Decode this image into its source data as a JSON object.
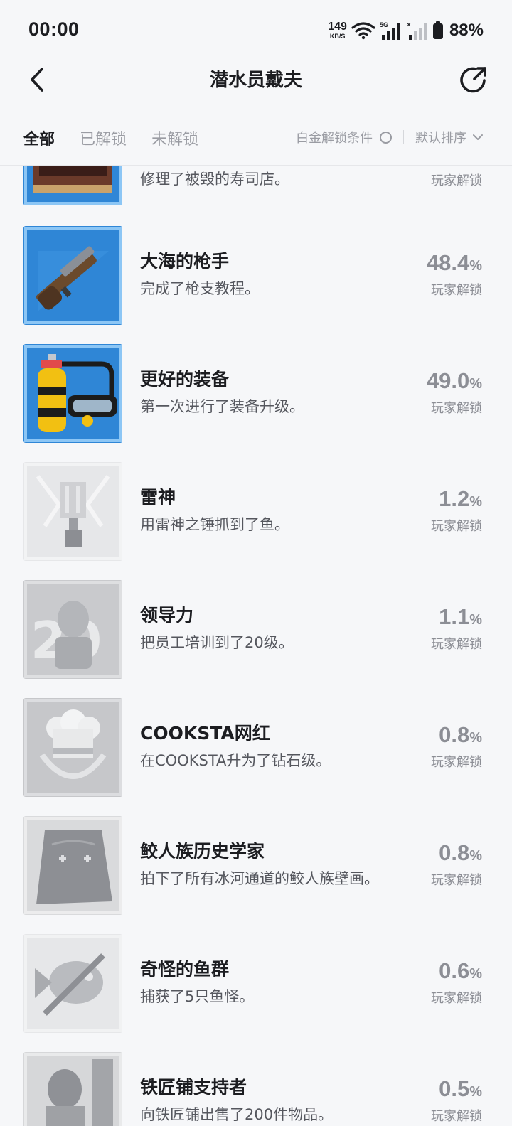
{
  "status_bar": {
    "time": "00:00",
    "net_speed": "149",
    "net_unit": "KB/S",
    "signal_label": "5G",
    "battery": "88%"
  },
  "header": {
    "title": "潜水员戴夫",
    "back_icon": "chevron-left-icon",
    "share_icon": "share-icon"
  },
  "filters": {
    "tabs": [
      "全部",
      "已解锁",
      "未解锁"
    ],
    "active_tab": "全部",
    "platinum_label": "白金解锁条件",
    "sort_label": "默认排序"
  },
  "colors": {
    "background": "#f6f7f9",
    "text_primary": "#1c1d21",
    "text_secondary": "#55575e",
    "text_muted": "#8c8e95",
    "badge_blue": "#2f86d6"
  },
  "achievements": [
    {
      "title": "",
      "desc": "修理了被毁的寿司店。",
      "pct": "",
      "unlock_label": "玩家解锁",
      "unlocked": true,
      "icon": "sushi-shop-icon"
    },
    {
      "title": "大海的枪手",
      "desc": "完成了枪支教程。",
      "pct": "48.4",
      "unlock_label": "玩家解锁",
      "unlocked": true,
      "icon": "harpoon-gun-icon"
    },
    {
      "title": "更好的装备",
      "desc": "第一次进行了装备升级。",
      "pct": "49.0",
      "unlock_label": "玩家解锁",
      "unlocked": true,
      "icon": "diving-tank-icon"
    },
    {
      "title": "雷神",
      "desc": "用雷神之锤抓到了鱼。",
      "pct": "1.2",
      "unlock_label": "玩家解锁",
      "unlocked": false,
      "icon": "thor-hammer-icon"
    },
    {
      "title": "领导力",
      "desc": "把员工培训到了20级。",
      "pct": "1.1",
      "unlock_label": "玩家解锁",
      "unlocked": false,
      "icon": "staff-level-20-icon"
    },
    {
      "title": "COOKSTA网红",
      "desc": "在COOKSTA升为了钻石级。",
      "pct": "0.8",
      "unlock_label": "玩家解锁",
      "unlocked": false,
      "icon": "chef-hat-icon"
    },
    {
      "title": "鲛人族历史学家",
      "desc": "拍下了所有冰河通道的鲛人族壁画。",
      "pct": "0.8",
      "unlock_label": "玩家解锁",
      "unlocked": false,
      "icon": "mural-icon"
    },
    {
      "title": "奇怪的鱼群",
      "desc": "捕获了5只鱼怪。",
      "pct": "0.6",
      "unlock_label": "玩家解锁",
      "unlocked": false,
      "icon": "fish-monster-icon"
    },
    {
      "title": "铁匠铺支持者",
      "desc": "向铁匠铺出售了200件物品。",
      "pct": "0.5",
      "unlock_label": "玩家解锁",
      "unlocked": false,
      "icon": "blacksmith-icon"
    }
  ]
}
